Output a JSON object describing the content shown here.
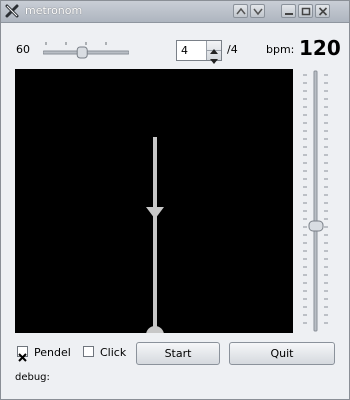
{
  "window": {
    "title": "metronom"
  },
  "controls": {
    "tempo_min_label": "60",
    "beats_value": "4",
    "beats_suffix": "/4",
    "bpm_label": "bpm:",
    "bpm_value": "120",
    "tempo_slider_level": 0.45,
    "bpm_slider_level": 0.4
  },
  "pendulum": {
    "position": "center"
  },
  "options": {
    "pendel_label": "Pendel",
    "pendel_checked": true,
    "click_label": "Click",
    "click_checked": false
  },
  "buttons": {
    "start": "Start",
    "quit": "Quit"
  },
  "status": {
    "debug_label": "debug:"
  },
  "icons": [
    "close-x-icon",
    "shade-up-icon",
    "shade-down-icon",
    "minimize-icon",
    "maximize-icon",
    "close-icon"
  ]
}
